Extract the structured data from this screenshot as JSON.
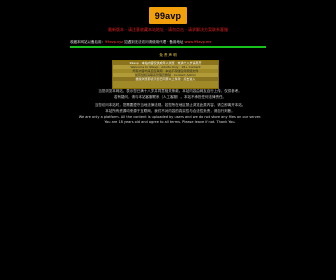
{
  "logo": {
    "text": "99avp"
  },
  "header": {
    "tagline_1": "最新版本 - 请注意收藏本站地址 - 请勿点击 - 请求解决方案联系客服",
    "tagline_2": ""
  },
  "info": {
    "prefix": "收藏本网站以备后用：",
    "highlight": "99avp.xyz",
    "middle": " 如遇到无法访问请使用代理 · 备用地址 ",
    "link": "www.99avp.me"
  },
  "section": {
    "center_mark": "免 责 声 明"
  },
  "notice": {
    "rows": [
      "99avp · 本站内容仅供成年人浏览 · 未满十八岁请离开",
      "Welcome to 99avp · Adults Only · 18+ Content",
      "所有内容均来自互联网 · 本站不存储任何视频文件",
      "如有侵权请联系管理员删除 · Contact Admin",
      "继续浏览即表示您已同意以上条款 · 点击进入"
    ]
  },
  "body": {
    "p1": "当您浏览本网站，表示您已满十八岁并同意相关条款。本站内容由网友自行上传，仅供参考。",
    "p2": "若有疑问，请与本站客服联系（人工客服）。本站不承担任何法律责任。",
    "p3": "当您访问本站时，您需要遵守当地法律法规。若您所在地区禁止浏览此类内容，请立即离开本站。",
    "p4": "本站所有资源均来源于互联网，我们不对内容的真实性与合法性负责，请自行判断。",
    "p5": "We are only a platform. All the content is uploaded by users and we do not store any files on our server.",
    "p6": "You are 18 years old and agree to all terms. Please leave if not. Thank You."
  }
}
